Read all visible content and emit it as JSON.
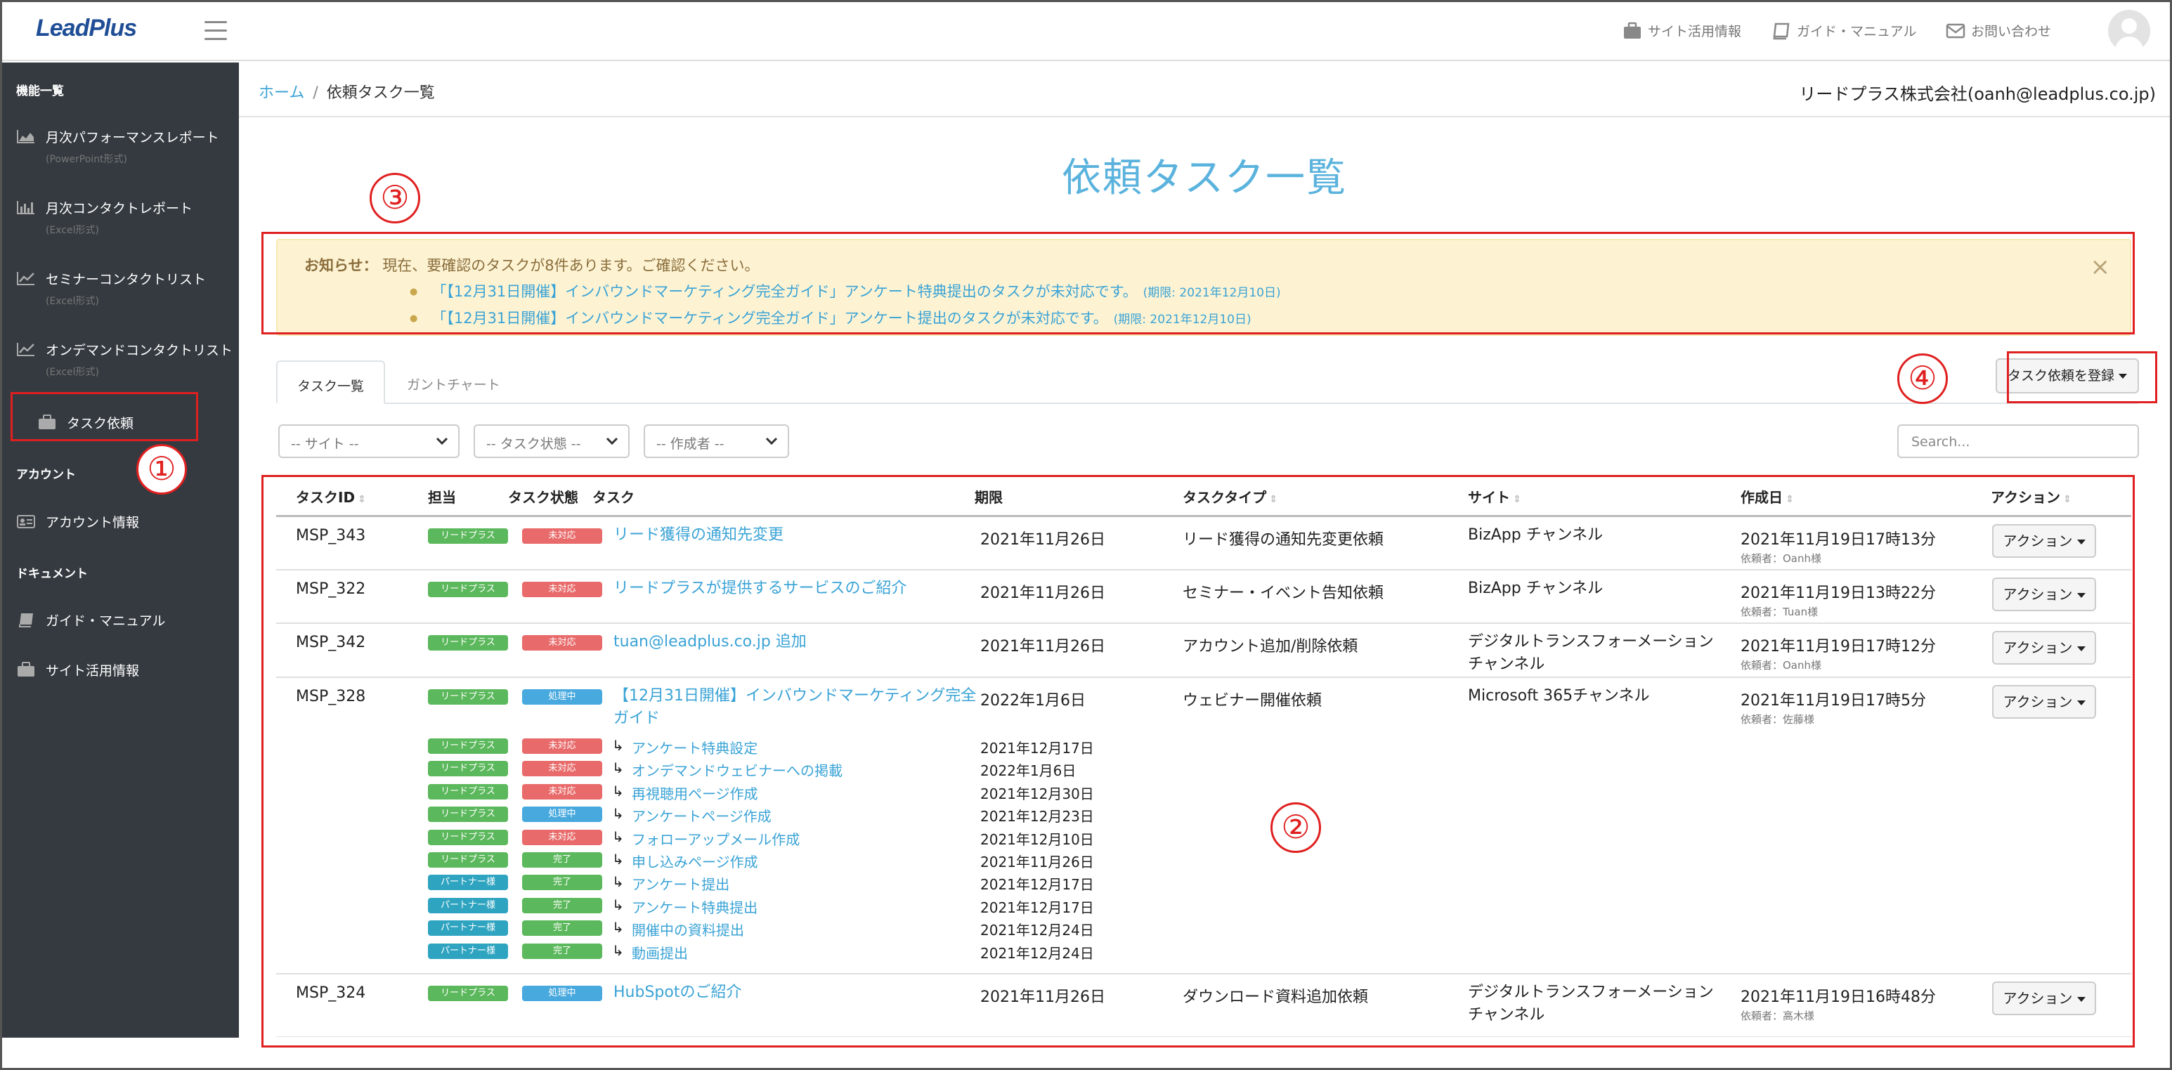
{
  "header": {
    "logo": "LeadPlus",
    "links": [
      {
        "label": "サイト活用情報",
        "icon": "briefcase-icon"
      },
      {
        "label": "ガイド・マニュアル",
        "icon": "book-icon"
      },
      {
        "label": "お問い合わせ",
        "icon": "envelope-icon"
      }
    ]
  },
  "sidebar": {
    "section_features": "機能一覧",
    "items": [
      {
        "label": "月次パフォーマンスレポート",
        "sub": "(PowerPoint形式)",
        "icon": "area-chart-icon"
      },
      {
        "label": "月次コンタクトレポート",
        "sub": "(Excel形式)",
        "icon": "bar-chart-icon"
      },
      {
        "label": "セミナーコンタクトリスト",
        "sub": "(Excel形式)",
        "icon": "line-chart-icon"
      },
      {
        "label": "オンデマンドコンタクトリスト",
        "sub": "(Excel形式)",
        "icon": "line-chart-icon"
      },
      {
        "label": "タスク依頼",
        "sub": "",
        "icon": "briefcase-icon"
      }
    ],
    "section_account": "アカウント",
    "account_items": [
      {
        "label": "アカウント情報",
        "icon": "id-card-icon"
      }
    ],
    "section_document": "ドキュメント",
    "document_items": [
      {
        "label": "ガイド・マニュアル",
        "icon": "book-icon"
      },
      {
        "label": "サイト活用情報",
        "icon": "briefcase-icon"
      }
    ]
  },
  "breadcrumb": {
    "home": "ホーム",
    "sep": "/",
    "current": "依頼タスク一覧"
  },
  "user": "リードプラス株式会社(oanh@leadplus.co.jp)",
  "page_title": "依頼タスク一覧",
  "callouts": [
    "①",
    "②",
    "③",
    "④"
  ],
  "alert": {
    "lead_bold": "お知らせ：",
    "lead_text": "現在、要確認のタスクが8件あります。ご確認ください。",
    "items": [
      {
        "text": "「【12月31日開催】インバウンドマーケティング完全ガイド」アンケート特典提出のタスクが未対応です。",
        "due": "(期限: 2021年12月10日)"
      },
      {
        "text": "「【12月31日開催】インバウンドマーケティング完全ガイド」アンケート提出のタスクが未対応です。",
        "due": "(期限: 2021年12月10日)"
      }
    ],
    "close": "×"
  },
  "tabs": [
    "タスク一覧",
    "ガントチャート"
  ],
  "register_button": "タスク依頼を登録",
  "filters": {
    "site": "-- サイト --",
    "status": "-- タスク状態 --",
    "author": "-- 作成者 --",
    "search_placeholder": "Search..."
  },
  "table": {
    "headers": {
      "id": "タスクID",
      "assignee": "担当",
      "status": "タスク状態",
      "task": "タスク",
      "due": "期限",
      "type": "タスクタイプ",
      "site": "サイト",
      "created": "作成日",
      "action": "アクション"
    },
    "action_label": "アクション",
    "rows": [
      {
        "id": "MSP_343",
        "assignee": "リードプラス",
        "status": "未対応",
        "task": "リード獲得の通知先変更",
        "due": "2021年11月26日",
        "type": "リード獲得の通知先変更依頼",
        "site": "BizApp チャンネル",
        "site2": "",
        "created": "2021年11月19日17時13分",
        "requester": "依頼者：Oanh様"
      },
      {
        "id": "MSP_322",
        "assignee": "リードプラス",
        "status": "未対応",
        "task": "リードプラスが提供するサービスのご紹介",
        "due": "2021年11月26日",
        "type": "セミナー・イベント告知依頼",
        "site": "BizApp チャンネル",
        "site2": "",
        "created": "2021年11月19日13時22分",
        "requester": "依頼者：Tuan様"
      },
      {
        "id": "MSP_342",
        "assignee": "リードプラス",
        "status": "未対応",
        "task": "tuan@leadplus.co.jp 追加",
        "due": "2021年11月26日",
        "type": "アカウント追加/削除依頼",
        "site": "デジタルトランスフォーメーション",
        "site2": "チャンネル",
        "created": "2021年11月19日17時12分",
        "requester": "依頼者：Oanh様"
      },
      {
        "id": "MSP_328",
        "assignee": "リードプラス",
        "status": "処理中",
        "task": "【12月31日開催】インバウンドマーケティング完全",
        "task2": "ガイド",
        "due": "2022年1月6日",
        "type": "ウェビナー開催依頼",
        "site": "Microsoft 365チャンネル",
        "site2": "",
        "created": "2021年11月19日17時5分",
        "requester": "依頼者：佐藤様"
      },
      {
        "id": "MSP_324",
        "assignee": "リードプラス",
        "status": "処理中",
        "task": "HubSpotのご紹介",
        "due": "2021年11月26日",
        "type": "ダウンロード資料追加依頼",
        "site": "デジタルトランスフォーメーション",
        "site2": "チャンネル",
        "created": "2021年11月19日16時48分",
        "requester": "依頼者：高木様"
      }
    ],
    "subtasks": [
      {
        "assignee": "リードプラス",
        "status": "未対応",
        "task": "アンケート特典設定",
        "due": "2021年12月17日"
      },
      {
        "assignee": "リードプラス",
        "status": "未対応",
        "task": "オンデマンドウェビナーへの掲載",
        "due": "2022年1月6日"
      },
      {
        "assignee": "リードプラス",
        "status": "未対応",
        "task": "再視聴用ページ作成",
        "due": "2021年12月30日"
      },
      {
        "assignee": "リードプラス",
        "status": "処理中",
        "task": "アンケートページ作成",
        "due": "2021年12月23日"
      },
      {
        "assignee": "リードプラス",
        "status": "未対応",
        "task": "フォローアップメール作成",
        "due": "2021年12月10日"
      },
      {
        "assignee": "リードプラス",
        "status": "完了",
        "task": "申し込みページ作成",
        "due": "2021年11月26日"
      },
      {
        "assignee": "パートナー様",
        "status": "完了",
        "task": "アンケート提出",
        "due": "2021年12月17日"
      },
      {
        "assignee": "パートナー様",
        "status": "完了",
        "task": "アンケート特典提出",
        "due": "2021年12月17日"
      },
      {
        "assignee": "パートナー様",
        "status": "完了",
        "task": "開催中の資料提出",
        "due": "2021年12月24日"
      },
      {
        "assignee": "パートナー様",
        "status": "完了",
        "task": "動画提出",
        "due": "2021年12月24日"
      }
    ],
    "arrow": "↳"
  },
  "colors": {
    "accent": "#3aa3d6",
    "sidebar": "#343a40",
    "annotation": "#e02020",
    "alert_bg": "#fdf3d3"
  }
}
